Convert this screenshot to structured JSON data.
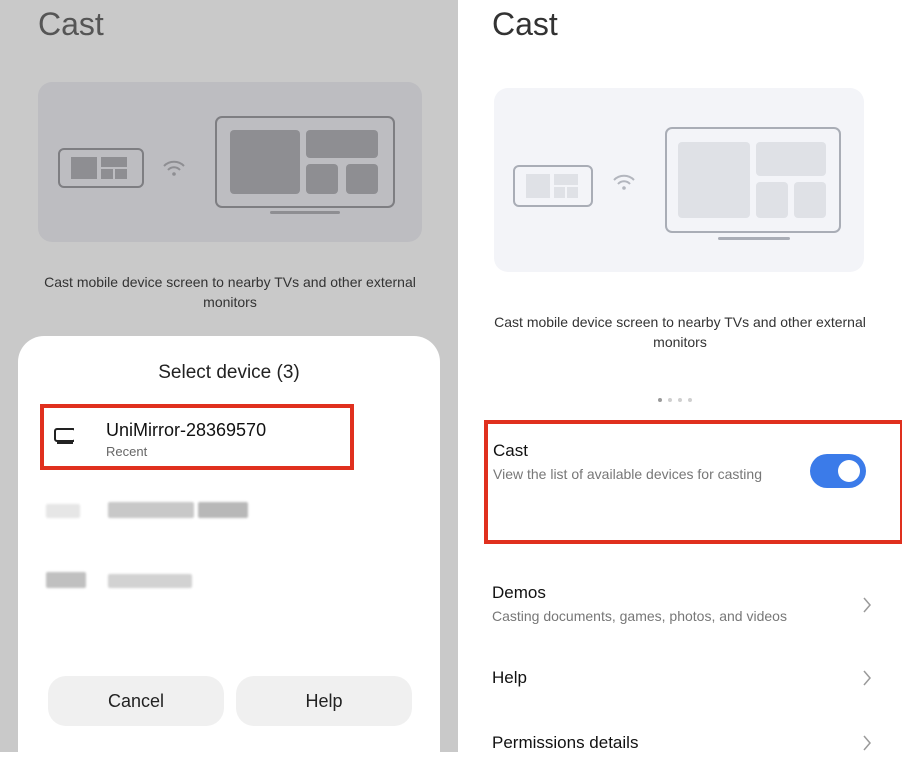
{
  "left": {
    "title": "Cast",
    "description": "Cast mobile device screen to nearby TVs and other external monitors",
    "sheet": {
      "title": "Select device (3)",
      "device": {
        "name": "UniMirror-28369570",
        "status": "Recent"
      },
      "cancel_label": "Cancel",
      "help_label": "Help"
    }
  },
  "right": {
    "title": "Cast",
    "description": "Cast mobile device screen to nearby TVs and other external monitors",
    "cast_setting": {
      "label": "Cast",
      "sub": "View the list of available devices for casting",
      "enabled": true
    },
    "menu": [
      {
        "label": "Demos",
        "sub": "Casting documents, games, photos, and videos"
      },
      {
        "label": "Help",
        "sub": ""
      },
      {
        "label": "Permissions details",
        "sub": ""
      }
    ]
  },
  "colors": {
    "accent": "#3b7be9",
    "highlight": "#e0301e"
  }
}
